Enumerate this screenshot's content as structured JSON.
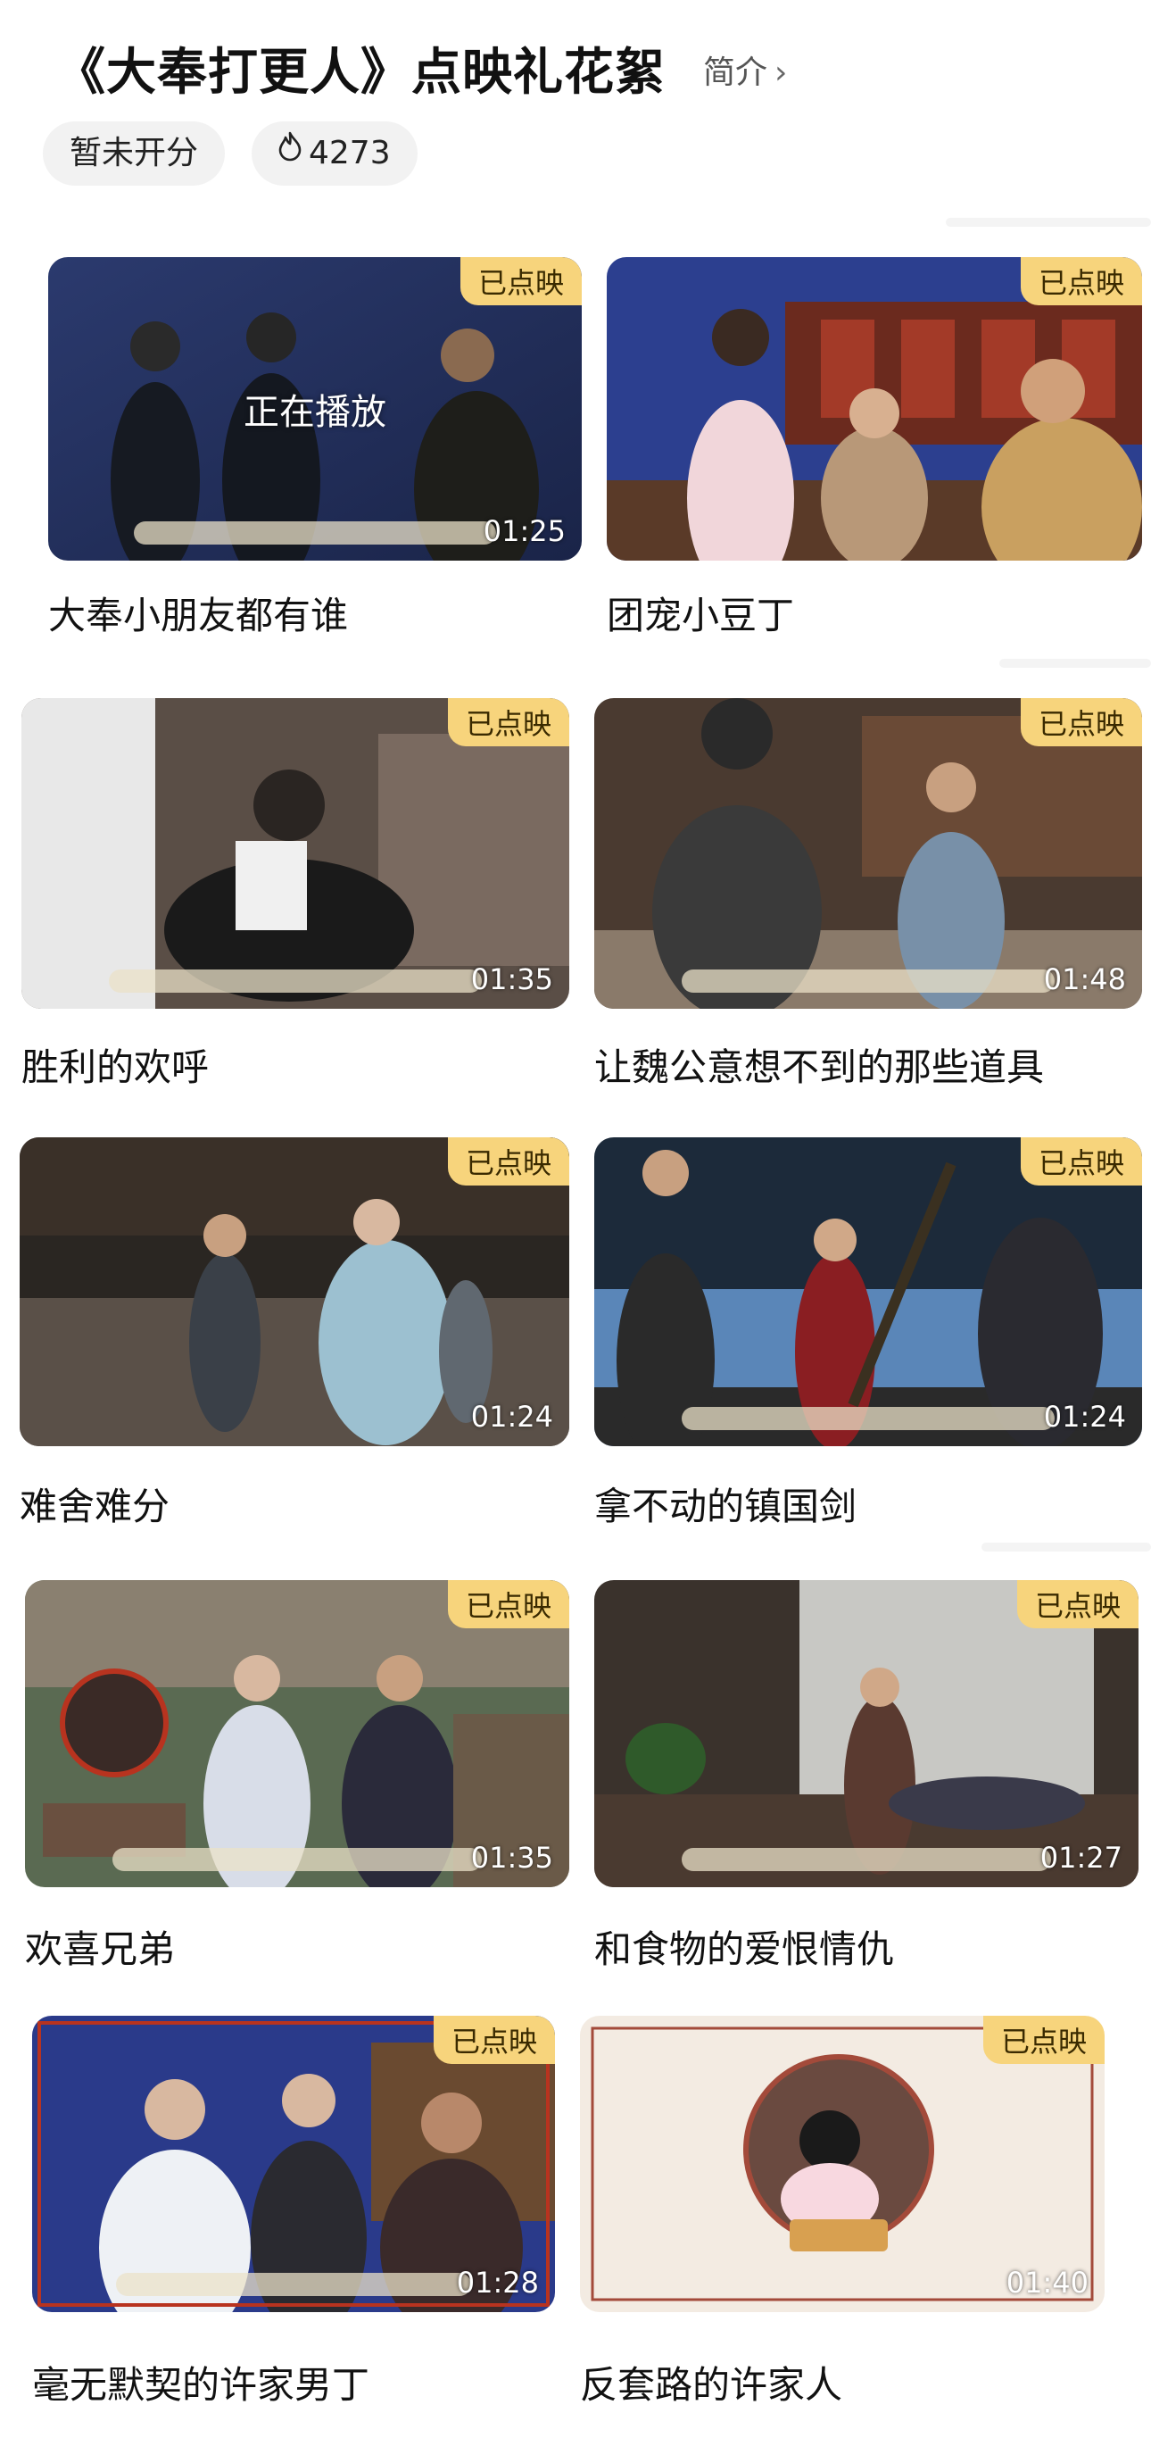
{
  "header": {
    "title": "《大奉打更人》点映礼花絮",
    "intro_label": "简介",
    "score_label": "暂未开分",
    "heat_count": "4273"
  },
  "colors": {
    "badge_bg": "#f7d47c",
    "pill_bg": "#f2f2f2"
  },
  "videos": [
    {
      "title": "大奉小朋友都有谁",
      "badge": "已点映",
      "duration": "01:25",
      "status": "正在播放"
    },
    {
      "title": "团宠小豆丁",
      "badge": "已点映",
      "duration": ""
    },
    {
      "title": "胜利的欢呼",
      "badge": "已点映",
      "duration": "01:35"
    },
    {
      "title": "让魏公意想不到的那些道具",
      "badge": "已点映",
      "duration": "01:48"
    },
    {
      "title": "难舍难分",
      "badge": "已点映",
      "duration": "01:24"
    },
    {
      "title": "拿不动的镇国剑",
      "badge": "已点映",
      "duration": "01:24"
    },
    {
      "title": "欢喜兄弟",
      "badge": "已点映",
      "duration": "01:35"
    },
    {
      "title": "和食物的爱恨情仇",
      "badge": "已点映",
      "duration": "01:27"
    },
    {
      "title": "毫无默契的许家男丁",
      "badge": "已点映",
      "duration": "01:28"
    },
    {
      "title": "反套路的许家人",
      "badge": "已点映",
      "duration": "01:40"
    }
  ]
}
